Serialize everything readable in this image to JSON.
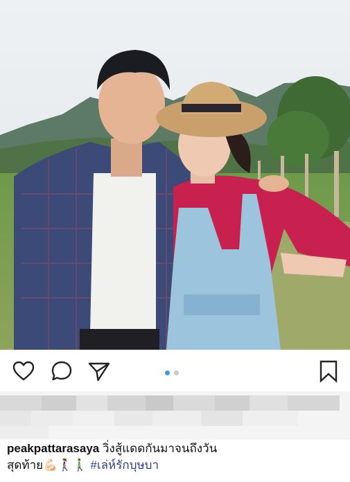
{
  "post": {
    "image_alt": "Couple standing in a vineyard in front of mountains",
    "carousel": {
      "count": 2,
      "active": 1
    }
  },
  "actions": {
    "like_icon": "heart-outline-icon",
    "comment_icon": "comment-bubble-icon",
    "share_icon": "paper-plane-icon",
    "save_icon": "bookmark-icon"
  },
  "caption": {
    "username": "peakpattarasaya",
    "text_line1": "วิ่งสู้แดดกันมาจนถึงวัน",
    "text_line2": "สุดท้าย💪🏻🚶‍♀️🚶‍♂️",
    "hashtag": "#เล่ห์รักบุษบา"
  },
  "colors": {
    "accent_dot": "#3897f0",
    "hashtag": "#2c3e8c"
  }
}
